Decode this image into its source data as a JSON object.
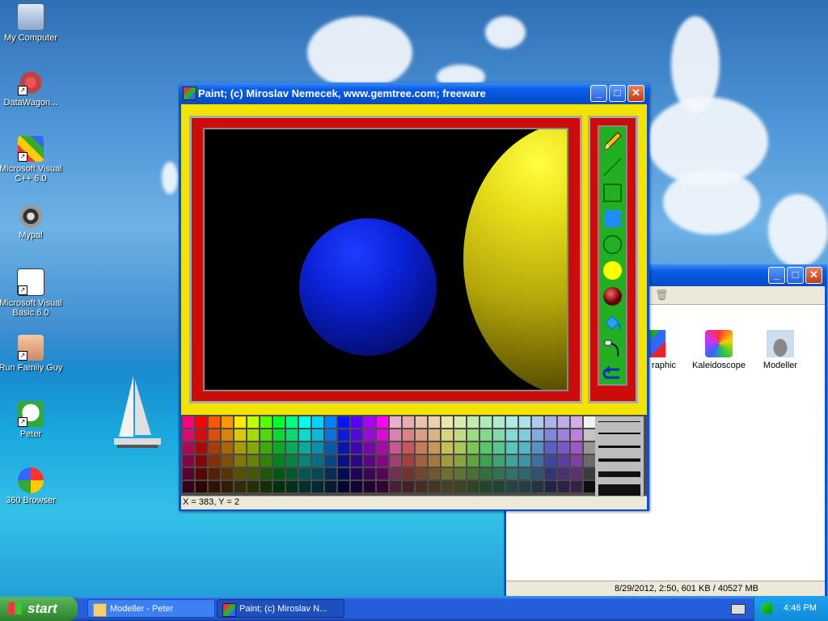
{
  "desktop": {
    "icons": [
      {
        "label": "My Computer",
        "icon": "computer-icon"
      },
      {
        "label": "DataWagon...",
        "icon": "datawagon-icon"
      },
      {
        "label": "Microsoft Visual C++ 6.0",
        "icon": "visual-cpp-icon"
      },
      {
        "label": "Mypal",
        "icon": "mypal-icon"
      },
      {
        "label": "Microsoft Visual Basic 6.0",
        "icon": "visual-basic-icon"
      },
      {
        "label": "Run Family Guy",
        "icon": "family-guy-icon"
      },
      {
        "label": "Peter",
        "icon": "peter-icon"
      },
      {
        "label": "360 Browser",
        "icon": "browser-360-icon"
      }
    ]
  },
  "paint_window": {
    "title": "Paint;   (c) Miroslav Nemecek, www.gemtree.com;   freeware",
    "status": "X = 383, Y = 2",
    "tools": [
      "pencil-tool-icon",
      "line-tool-icon",
      "rectangle-tool-icon",
      "filled-rectangle-tool-icon",
      "circle-tool-icon",
      "filled-circle-tool-icon",
      "sphere-tool-icon",
      "fill-bucket-tool-icon",
      "spray-tool-icon",
      "undo-tool-icon"
    ],
    "colors": {
      "frame_yellow": "#f2e400",
      "frame_red": "#cc0b0b",
      "tool_green": "#22b022",
      "canvas": "#000000"
    }
  },
  "explorer_window": {
    "items": [
      {
        "label": "raphic",
        "icon": "graphic-icon"
      },
      {
        "label": "Kaleidoscope",
        "icon": "kaleidoscope-icon"
      },
      {
        "label": "Modeller",
        "icon": "modeller-icon"
      }
    ],
    "status": "8/29/2012, 2:50, 601 KB / 40527 MB"
  },
  "taskbar": {
    "start_label": "start",
    "tasks": [
      {
        "label": "Modeller - Peter",
        "icon": "folder-icon"
      },
      {
        "label": "Paint;  (c) Miroslav N...",
        "icon": "paint-app-icon"
      }
    ],
    "clock": "4:46 PM"
  }
}
